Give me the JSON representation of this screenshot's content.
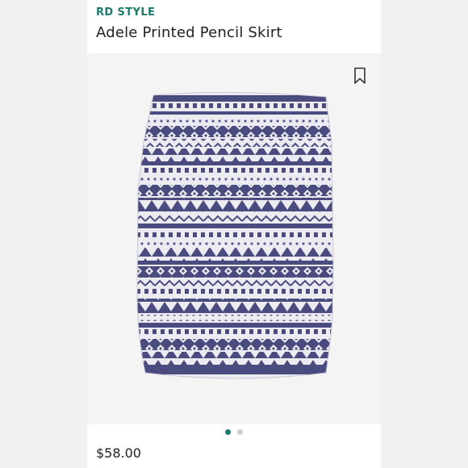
{
  "product": {
    "brand": "RD STYLE",
    "title": "Adele Printed Pencil Skirt",
    "price": "$58.00"
  },
  "gallery": {
    "image_count": 2,
    "active_index": 0,
    "image_alt": "skirt-image"
  },
  "icons": {
    "bookmark": "bookmark-icon"
  },
  "colors": {
    "accent": "#1f7a6e",
    "pattern_navy": "#4a4c80",
    "pattern_light": "#ecebf2"
  }
}
